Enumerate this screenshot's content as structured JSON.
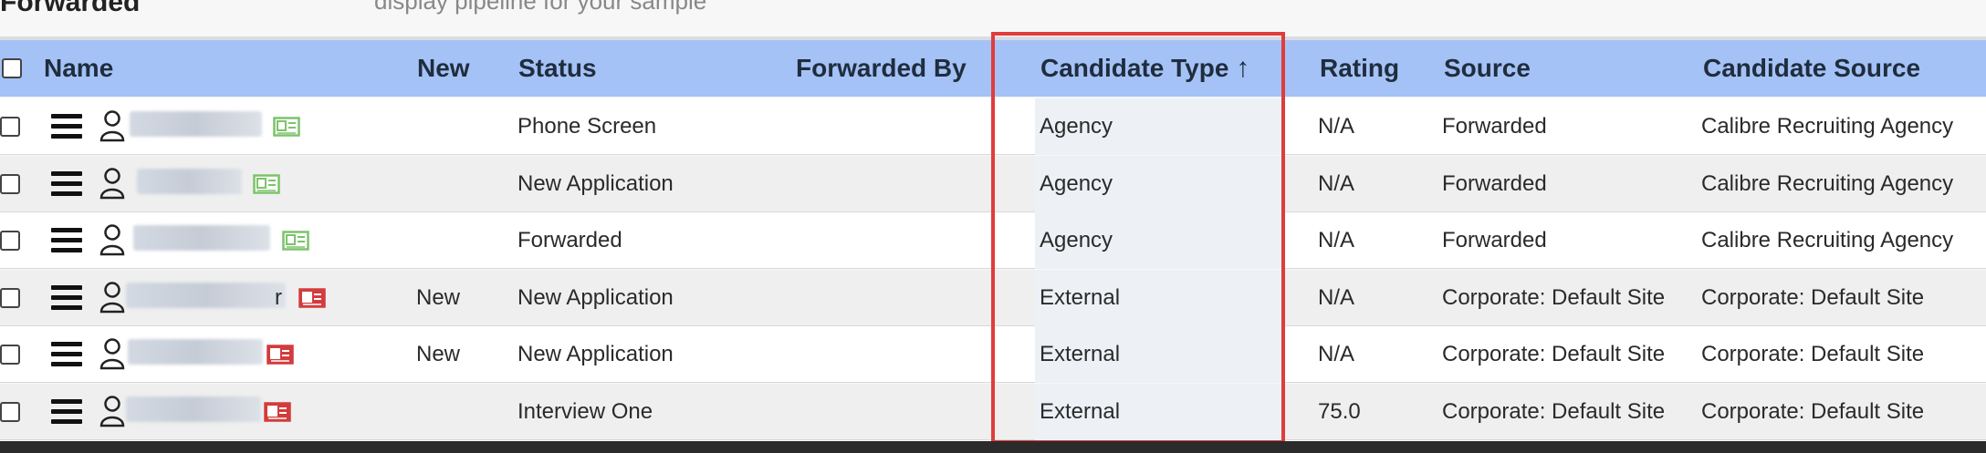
{
  "page": {
    "title_fragment": "Forwarded",
    "description_fragment": "display pipeline for your sample"
  },
  "table": {
    "columns": {
      "name": "Name",
      "new": "New",
      "status": "Status",
      "forwarded_by": "Forwarded By",
      "candidate_type": "Candidate Type",
      "sort_arrow": "↑",
      "rating": "Rating",
      "source": "Source",
      "candidate_source": "Candidate Source"
    },
    "rows": [
      {
        "name_suffix": "",
        "new": "",
        "status": "Phone Screen",
        "forwarded_by": "",
        "candidate_type": "Agency",
        "rating": "N/A",
        "source": "Forwarded",
        "candidate_source": "Calibre Recruiting Agency",
        "resume_icon": "green-resume-icon"
      },
      {
        "name_suffix": "",
        "new": "",
        "status": "New Application",
        "forwarded_by": "",
        "candidate_type": "Agency",
        "rating": "N/A",
        "source": "Forwarded",
        "candidate_source": "Calibre Recruiting Agency",
        "resume_icon": "green-resume-icon"
      },
      {
        "name_suffix": "",
        "new": "",
        "status": "Forwarded",
        "forwarded_by": "",
        "candidate_type": "Agency",
        "rating": "N/A",
        "source": "Forwarded",
        "candidate_source": "Calibre Recruiting Agency",
        "resume_icon": "green-resume-icon"
      },
      {
        "name_suffix": "r",
        "new": "New",
        "status": "New Application",
        "forwarded_by": "",
        "candidate_type": "External",
        "rating": "N/A",
        "source": "Corporate: Default Site",
        "candidate_source": "Corporate: Default Site",
        "resume_icon": "red-resume-icon"
      },
      {
        "name_suffix": "",
        "new": "New",
        "status": "New Application",
        "forwarded_by": "",
        "candidate_type": "External",
        "rating": "N/A",
        "source": "Corporate: Default Site",
        "candidate_source": "Corporate: Default Site",
        "resume_icon": "red-resume-icon"
      },
      {
        "name_suffix": "",
        "new": "",
        "status": "Interview One",
        "forwarded_by": "",
        "candidate_type": "External",
        "rating": "75.0",
        "source": "Corporate: Default Site",
        "candidate_source": "Corporate: Default Site",
        "resume_icon": "red-resume-icon"
      }
    ]
  },
  "colors": {
    "header_bg": "#a5c2f7",
    "highlight_border": "#e03c3c",
    "green_resume": "#7cc36b",
    "red_resume": "#d23c3c"
  }
}
